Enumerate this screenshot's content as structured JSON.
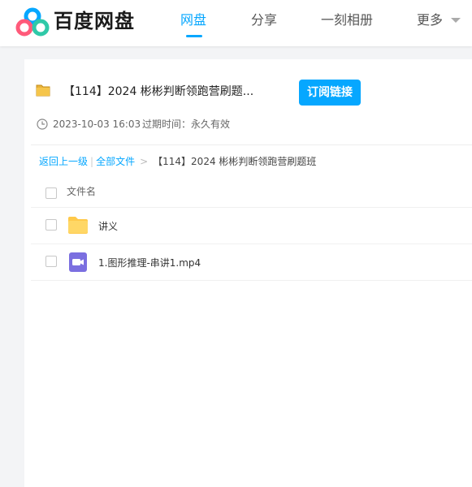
{
  "header": {
    "brand": "百度网盘",
    "nav": [
      {
        "label": "网盘",
        "active": true
      },
      {
        "label": "分享",
        "active": false
      },
      {
        "label": "一刻相册",
        "active": false
      },
      {
        "label": "更多",
        "active": false
      }
    ]
  },
  "share": {
    "title": "【114】2024 彬彬判断领跑营刷题...",
    "subscribe_label": "订阅链接",
    "date": "2023-10-03 16:03",
    "expire_label": "过期时间：",
    "expire_value": "永久有效"
  },
  "breadcrumb": {
    "back": "返回上一级",
    "separator": "|",
    "all_files": "全部文件",
    "arrow": ">",
    "current": "【114】2024 彬彬判断领跑营刷题班"
  },
  "file_list": {
    "column_name": "文件名",
    "rows": [
      {
        "name": "讲义",
        "icon": "folder-icon"
      },
      {
        "name": "1.图形推理-串讲1.mp4",
        "icon": "video-file-icon"
      }
    ]
  },
  "colors": {
    "accent": "#06a7ff",
    "folder": "#ffc94a",
    "video": "#7b6fe0"
  }
}
